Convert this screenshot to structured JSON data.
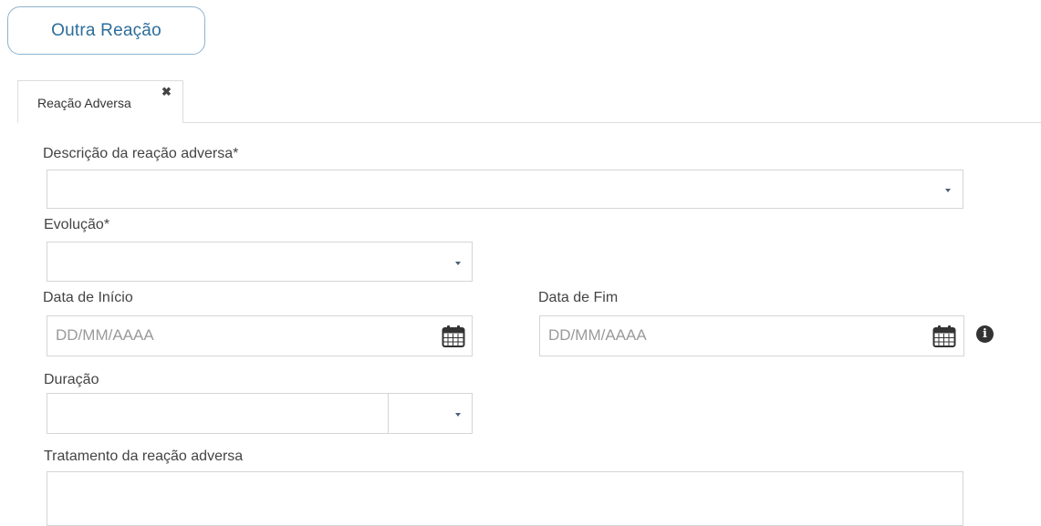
{
  "top_text": "",
  "add_reaction_button": "Outra Reação",
  "tab": {
    "label": "Reação Adversa",
    "close": "✖"
  },
  "fields": {
    "description": {
      "label": "Descrição da reação adversa*",
      "value": ""
    },
    "evolution": {
      "label": "Evolução*",
      "value": ""
    },
    "start_date": {
      "label": "Data de Início",
      "placeholder": "DD/MM/AAAA"
    },
    "end_date": {
      "label": "Data de Fim",
      "placeholder": "DD/MM/AAAA"
    },
    "duration": {
      "label": "Duração",
      "value": "",
      "unit": ""
    },
    "treatment": {
      "label": "Tratamento da reação adversa",
      "value": ""
    }
  },
  "icons": {
    "calendar": "calendar-icon",
    "info": "info-icon",
    "dropdown": "chevron-down-icon",
    "close": "close-icon"
  },
  "colors": {
    "button_border": "#8fb3cf",
    "button_text": "#2d6d9b",
    "border": "#d5d5d5",
    "caret": "#4a6178"
  },
  "info_glyph": "i"
}
